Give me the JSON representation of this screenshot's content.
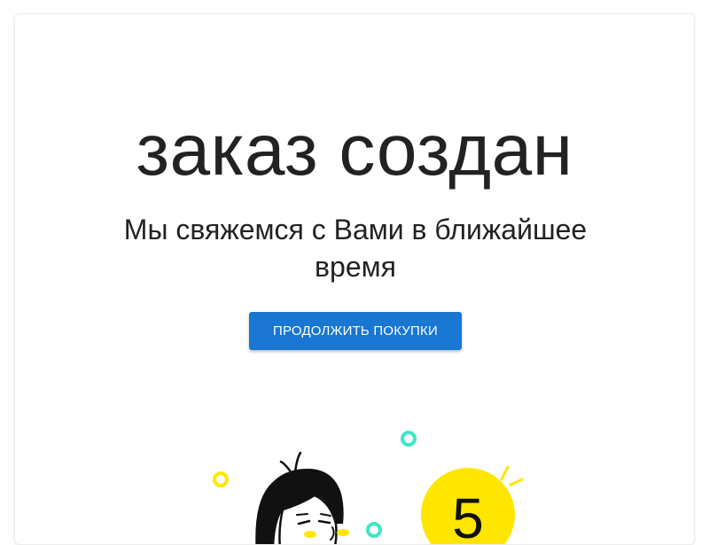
{
  "confirmation": {
    "title": "заказ создан",
    "subtitle": "Мы свяжемся с Вами в ближайшее время",
    "continue_button_label": "ПРОДОЛЖИТЬ ПОКУПКИ"
  },
  "illustration": {
    "coin_number": "5",
    "icon_name": "person-with-coin-illustration"
  },
  "colors": {
    "accent": "#1976d2",
    "text": "#222222",
    "coin_yellow": "#ffe600",
    "ring_teal": "#3ee6c4",
    "ring_yellow": "#ffe600",
    "ink": "#111111"
  }
}
